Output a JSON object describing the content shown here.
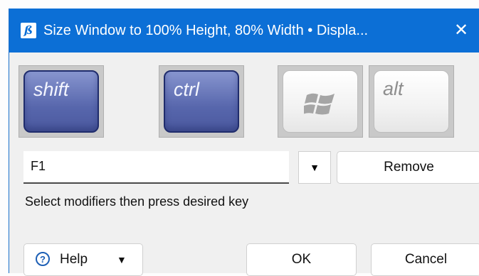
{
  "window": {
    "title": "Size Window to 100% Height, 80% Width • Displa...",
    "close_glyph": "✕",
    "icon": "app-icon"
  },
  "modifiers": [
    {
      "id": "shift",
      "label": "shift",
      "active": true
    },
    {
      "id": "ctrl",
      "label": "ctrl",
      "active": true
    },
    {
      "id": "win",
      "label": "",
      "icon": "windows-logo-icon",
      "active": false
    },
    {
      "id": "alt",
      "label": "alt",
      "active": false
    }
  ],
  "hotkey": {
    "value": "F1",
    "dropdown_glyph": "▼"
  },
  "buttons": {
    "remove": "Remove",
    "help": "Help",
    "help_arrow": "▼",
    "ok": "OK",
    "cancel": "Cancel"
  },
  "hint": "Select modifiers then press desired key",
  "colors": {
    "titlebar": "#0c6fd6",
    "active_key": "#5766ac",
    "help_icon": "#1d5fb5"
  }
}
